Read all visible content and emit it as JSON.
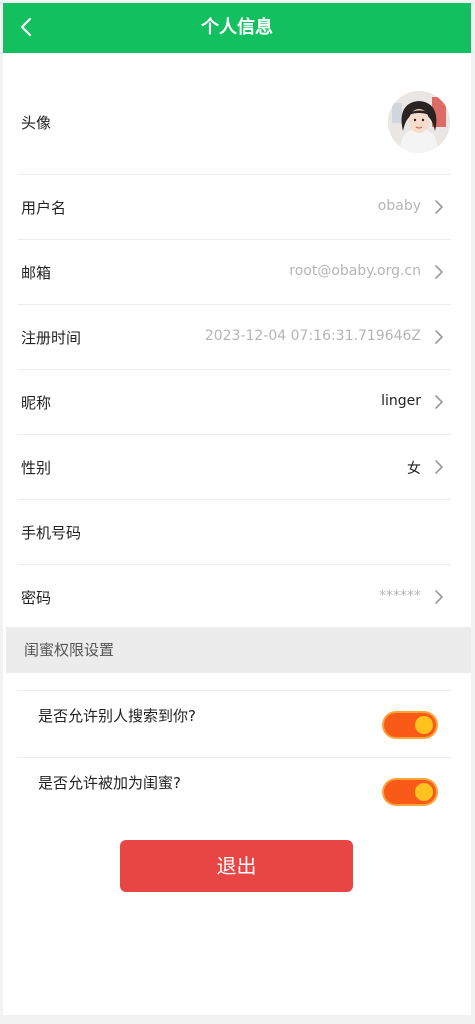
{
  "header": {
    "title": "个人信息",
    "back_icon": "chevron-left-icon",
    "bg_color": "#13c05f"
  },
  "profile": {
    "avatar_label": "头像",
    "rows": [
      {
        "key": "username",
        "label": "用户名",
        "value": "obaby",
        "style": "muted",
        "has_arrow": true
      },
      {
        "key": "email",
        "label": "邮箱",
        "value": "root@obaby.org.cn",
        "style": "muted",
        "has_arrow": true
      },
      {
        "key": "register-time",
        "label": "注册时间",
        "value": "2023-12-04 07:16:31.719646Z",
        "style": "muted",
        "has_arrow": true
      },
      {
        "key": "nickname",
        "label": "昵称",
        "value": "linger",
        "style": "dark",
        "has_arrow": true
      },
      {
        "key": "gender",
        "label": "性别",
        "value": "女",
        "style": "dark",
        "has_arrow": true
      },
      {
        "key": "phone",
        "label": "手机号码",
        "value": "",
        "style": "muted",
        "has_arrow": false
      },
      {
        "key": "password",
        "label": "密码",
        "value": "******",
        "style": "muted",
        "has_arrow": true
      }
    ]
  },
  "permissions": {
    "section_title": "闺蜜权限设置",
    "toggles": [
      {
        "key": "allow-search",
        "label": "是否允许别人搜索到你?",
        "on": true
      },
      {
        "key": "allow-add",
        "label": "是否允许被加为闺蜜?",
        "on": true
      }
    ],
    "toggle_color": "#fa5a18"
  },
  "logout": {
    "label": "退出",
    "color": "#e84545"
  }
}
